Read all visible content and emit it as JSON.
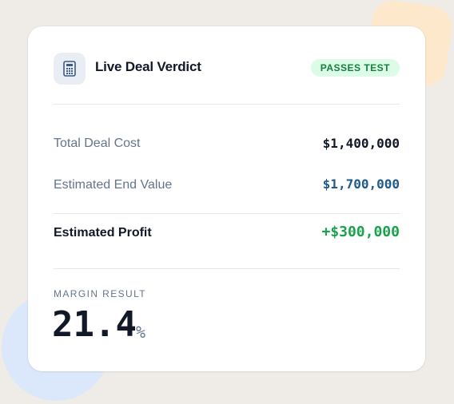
{
  "card": {
    "icon": "calculator-icon",
    "title": "Live Deal Verdict",
    "badge": "PASSES TEST"
  },
  "rows": [
    {
      "label": "Total Deal Cost",
      "value": "$1,400,000",
      "color": "#111827"
    },
    {
      "label": "Estimated End Value",
      "value": "$1,700,000",
      "color": "#1e5a8a"
    }
  ],
  "profit": {
    "label": "Estimated Profit",
    "value": "+$300,000",
    "color": "#16a34a"
  },
  "margin": {
    "label": "MARGIN RESULT",
    "value": "21.4",
    "unit": "%"
  },
  "colors": {
    "badge_bg": "#dcfce7",
    "badge_text": "#15803d",
    "background": "#efece8"
  }
}
